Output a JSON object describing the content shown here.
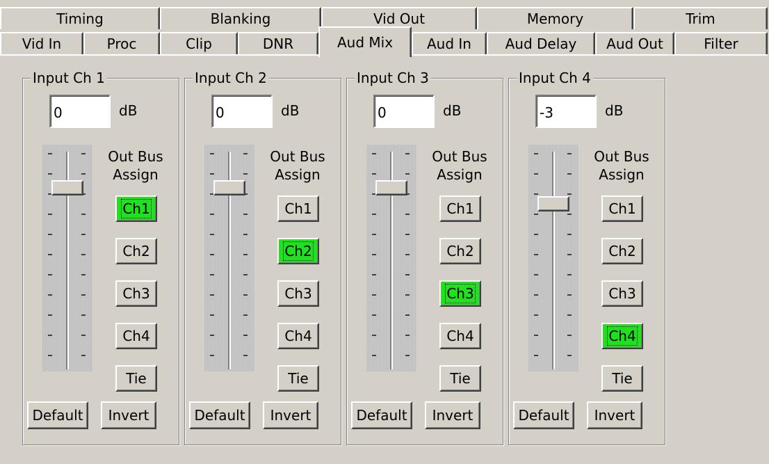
{
  "tabs_back": [
    {
      "label": "Timing",
      "active": false
    },
    {
      "label": "Blanking",
      "active": false
    },
    {
      "label": "Vid Out",
      "active": false
    },
    {
      "label": "Memory",
      "active": false
    },
    {
      "label": "Trim",
      "active": false
    }
  ],
  "tabs_front": [
    {
      "label": "Vid In",
      "active": false
    },
    {
      "label": "Proc",
      "active": false
    },
    {
      "label": "Clip",
      "active": false
    },
    {
      "label": "DNR",
      "active": false
    },
    {
      "label": "Aud Mix",
      "active": true
    },
    {
      "label": "Aud In",
      "active": false
    },
    {
      "label": "Aud Delay",
      "active": false
    },
    {
      "label": "Aud Out",
      "active": false
    },
    {
      "label": "Filter",
      "active": false
    }
  ],
  "unit_label": "dB",
  "bus_label_line1": "Out Bus",
  "bus_label_line2": "Assign",
  "bus_buttons": [
    "Ch1",
    "Ch2",
    "Ch3",
    "Ch4",
    "Tie"
  ],
  "default_label": "Default",
  "invert_label": "Invert",
  "colors": {
    "background": "#d4d0c8",
    "active_bus": "#20e020"
  },
  "channels": [
    {
      "title": "Input Ch 1",
      "gain": "0",
      "fader_level": 0.86,
      "active_bus": "Ch1"
    },
    {
      "title": "Input Ch 2",
      "gain": "0",
      "fader_level": 0.86,
      "active_bus": "Ch2"
    },
    {
      "title": "Input Ch 3",
      "gain": "0",
      "fader_level": 0.86,
      "active_bus": "Ch3"
    },
    {
      "title": "Input Ch 4",
      "gain": "-3",
      "fader_level": 0.78,
      "active_bus": "Ch4"
    }
  ]
}
